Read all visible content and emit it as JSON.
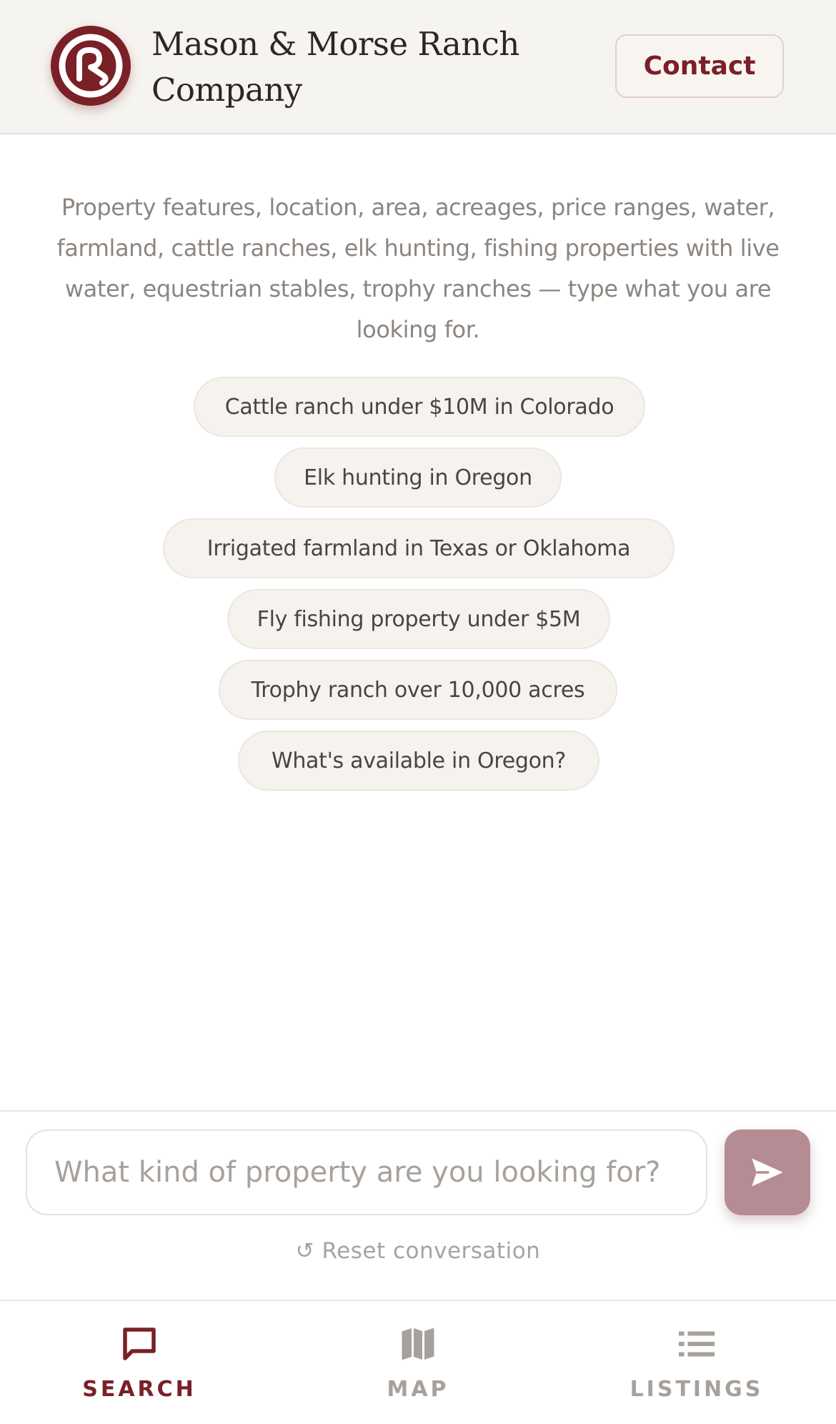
{
  "header": {
    "brand": "Mason & Morse Ranch Company",
    "brand_line1": "Mason & Morse Ranch",
    "brand_line2": "Company",
    "contact_label": "Contact"
  },
  "intro": {
    "text": "Property features, location, area, acreages, price ranges, water, farmland, cattle ranches, elk hunting, fishing properties with live water, equestrian stables, trophy ranches — type what you are looking for."
  },
  "suggestions": [
    "Cattle ranch under $10M in Colorado",
    "Elk hunting in Oregon",
    "Irrigated farmland in Texas or Oklahoma",
    "Fly fishing property under $5M",
    "Trophy ranch over 10,000 acres",
    "What's available in Oregon?"
  ],
  "search": {
    "placeholder": "What kind of property are you looking for?",
    "reset_label": "↺ Reset conversation"
  },
  "nav": {
    "items": [
      {
        "label": "SEARCH",
        "icon": "chat-icon",
        "active": true
      },
      {
        "label": "MAP",
        "icon": "map-icon",
        "active": false
      },
      {
        "label": "LISTINGS",
        "icon": "list-icon",
        "active": false
      }
    ]
  },
  "colors": {
    "brand": "#7a2027",
    "send_button": "#b68c94",
    "muted": "#a8a19b",
    "header_bg": "#f6f4f0"
  }
}
